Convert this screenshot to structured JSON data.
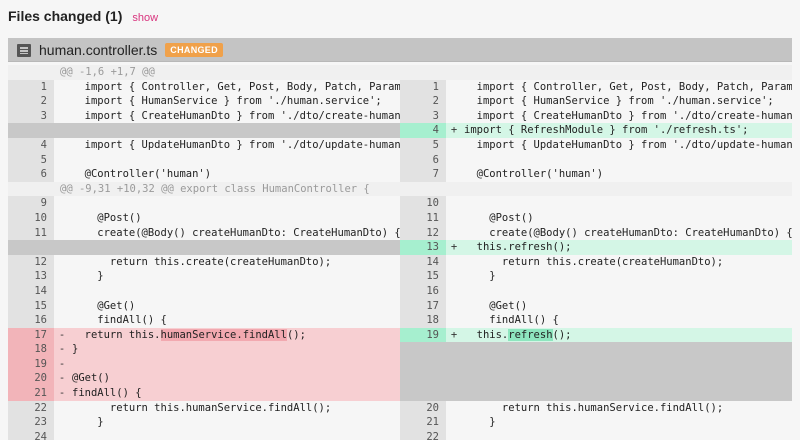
{
  "header": {
    "title": "Files changed (1)",
    "show_label": "show"
  },
  "file": {
    "name": "human.controller.ts",
    "badge": "CHANGED"
  },
  "hunks": [
    {
      "header": "@@ -1,6 +1,7 @@",
      "rows": [
        {
          "l": {
            "n": "1",
            "c": "  import { Controller, Get, Post, Body, Patch, Param, D"
          },
          "r": {
            "n": "1",
            "c": "  import { Controller, Get, Post, Body, Patch, Param, D"
          }
        },
        {
          "l": {
            "n": "2",
            "c": "  import { HumanService } from './human.service';"
          },
          "r": {
            "n": "2",
            "c": "  import { HumanService } from './human.service';"
          }
        },
        {
          "l": {
            "n": "3",
            "c": "  import { CreateHumanDto } from './dto/create-human.dt"
          },
          "r": {
            "n": "3",
            "c": "  import { CreateHumanDto } from './dto/create-human.dt"
          }
        },
        {
          "l": {
            "type": "empty"
          },
          "r": {
            "type": "add",
            "n": "4",
            "s": "+",
            "c": "import { RefreshModule } from './refresh.ts';"
          }
        },
        {
          "l": {
            "n": "4",
            "c": "  import { UpdateHumanDto } from './dto/update-human.dt"
          },
          "r": {
            "n": "5",
            "c": "  import { UpdateHumanDto } from './dto/update-human.dt"
          }
        },
        {
          "l": {
            "n": "5",
            "c": ""
          },
          "r": {
            "n": "6",
            "c": ""
          }
        },
        {
          "l": {
            "n": "6",
            "c": "  @Controller('human')"
          },
          "r": {
            "n": "7",
            "c": "  @Controller('human')"
          }
        }
      ]
    },
    {
      "header": "@@ -9,31 +10,32 @@ export class HumanController {",
      "rows": [
        {
          "l": {
            "n": "9",
            "c": ""
          },
          "r": {
            "n": "10",
            "c": ""
          }
        },
        {
          "l": {
            "n": "10",
            "c": "    @Post()"
          },
          "r": {
            "n": "11",
            "c": "    @Post()"
          }
        },
        {
          "l": {
            "n": "11",
            "c": "    create(@Body() createHumanDto: CreateHumanDto) {"
          },
          "r": {
            "n": "12",
            "c": "    create(@Body() createHumanDto: CreateHumanDto) {"
          }
        },
        {
          "l": {
            "type": "empty"
          },
          "r": {
            "type": "add",
            "n": "13",
            "s": "+",
            "c": "  this.refresh();"
          }
        },
        {
          "l": {
            "n": "12",
            "c": "      return this.create(createHumanDto);"
          },
          "r": {
            "n": "14",
            "c": "      return this.create(createHumanDto);"
          }
        },
        {
          "l": {
            "n": "13",
            "c": "    }"
          },
          "r": {
            "n": "15",
            "c": "    }"
          }
        },
        {
          "l": {
            "n": "14",
            "c": ""
          },
          "r": {
            "n": "16",
            "c": ""
          }
        },
        {
          "l": {
            "n": "15",
            "c": "    @Get()"
          },
          "r": {
            "n": "17",
            "c": "    @Get()"
          }
        },
        {
          "l": {
            "n": "16",
            "c": "    findAll() {"
          },
          "r": {
            "n": "18",
            "c": "    findAll() {"
          }
        },
        {
          "l": {
            "type": "del",
            "n": "17",
            "s": "-",
            "c": "  return this.",
            "hl": "humanService.findAll",
            "tail": "();"
          },
          "r": {
            "type": "add",
            "n": "19",
            "s": "+",
            "c": "  this.",
            "hl": "refresh",
            "tail": "();"
          }
        },
        {
          "l": {
            "type": "del",
            "n": "18",
            "s": "-",
            "c": "}"
          },
          "r": {
            "type": "empty"
          }
        },
        {
          "l": {
            "type": "del",
            "n": "19",
            "s": "-",
            "c": ""
          },
          "r": {
            "type": "empty"
          }
        },
        {
          "l": {
            "type": "del",
            "n": "20",
            "s": "-",
            "c": "@Get()"
          },
          "r": {
            "type": "empty"
          }
        },
        {
          "l": {
            "type": "del",
            "n": "21",
            "s": "-",
            "c": "findAll() {"
          },
          "r": {
            "type": "empty"
          }
        },
        {
          "l": {
            "n": "22",
            "c": "      return this.humanService.findAll();"
          },
          "r": {
            "n": "20",
            "c": "      return this.humanService.findAll();"
          }
        },
        {
          "l": {
            "n": "23",
            "c": "    }"
          },
          "r": {
            "n": "21",
            "c": "    }"
          }
        },
        {
          "l": {
            "n": "24",
            "c": ""
          },
          "r": {
            "n": "22",
            "c": ""
          }
        }
      ]
    }
  ]
}
